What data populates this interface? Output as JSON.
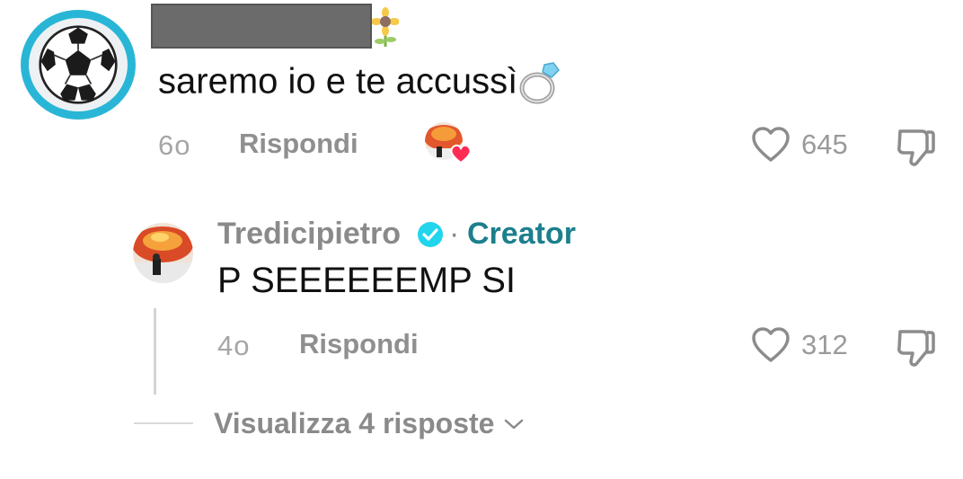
{
  "comment": {
    "text": "saremo io e te accussì",
    "time": "6o",
    "reply_label": "Rispondi",
    "likes": "645"
  },
  "reply": {
    "username": "Tredicipietro",
    "creator_label": "Creator",
    "text": "P SEEEEEEMP SI",
    "time": "4o",
    "reply_label": "Rispondi",
    "likes": "312"
  },
  "view_replies": "Visualizza 4 risposte",
  "icons": {
    "like": "heart-outline-icon",
    "dislike": "thumbs-down-icon",
    "verified": "verified-badge-icon",
    "ring": "ring-emoji",
    "flower": "sunflower-emoji"
  },
  "colors": {
    "creator": "#1c7f8d",
    "verified": "#20d5ec",
    "avatar_ring": "#29b6d6",
    "liked_heart": "#fe2c55"
  }
}
